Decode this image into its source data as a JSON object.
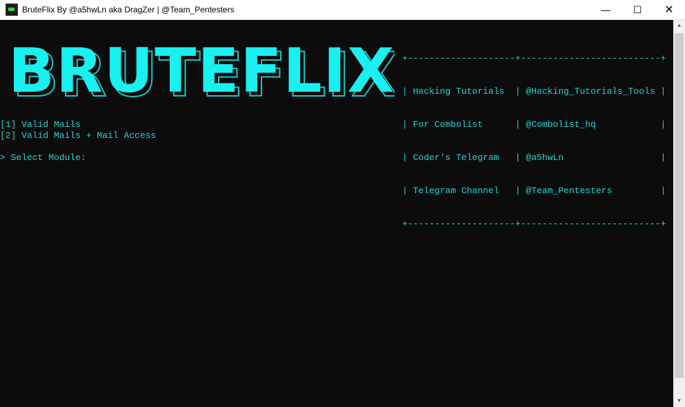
{
  "window": {
    "title": "BruteFlix By @a5hwLn aka DragZer | @Team_Pentesters",
    "minimize": "—",
    "maximize": "☐",
    "close": "✕"
  },
  "logo": {
    "text": "BRUTEFLIX",
    "color": "#19f0f0",
    "outline": "#19c6c6"
  },
  "info_box": {
    "border_top": "+--------------------+--------------------------+",
    "rows": [
      "| Hacking Tutorials  | @Hacking_Tutorials_Tools |",
      "| For Combolist      | @Combolist_hq            |",
      "| Coder's Telegram   | @a5hwLn                  |",
      "| Telegram Channel   | @Team_Pentesters         |"
    ],
    "border_bottom": "+--------------------+--------------------------+"
  },
  "menu": {
    "options": [
      "[1] Valid Mails",
      "[2] Valid Mails + Mail Access"
    ],
    "prompt": "> Select Module:"
  },
  "colors": {
    "text": "#1fd6d6",
    "background": "#0c0c0c"
  }
}
